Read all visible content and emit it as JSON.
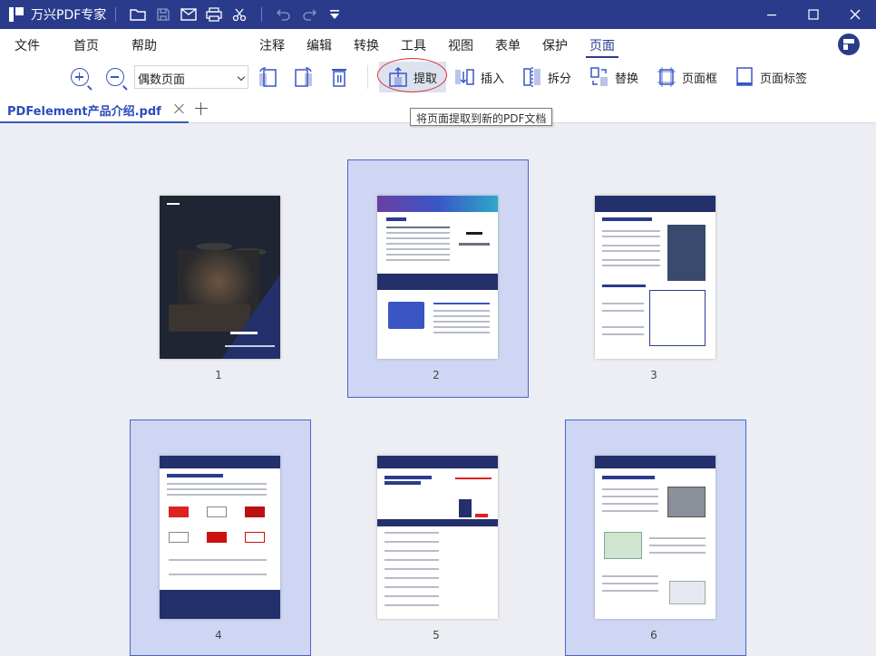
{
  "app": {
    "title": "万兴PDF专家"
  },
  "menu": {
    "left": [
      "文件",
      "首页",
      "帮助"
    ],
    "right": [
      "注释",
      "编辑",
      "转换",
      "工具",
      "视图",
      "表单",
      "保护",
      "页面"
    ],
    "active": "页面"
  },
  "toolbar": {
    "page_mode_value": "偶数页面",
    "extract_label": "提取",
    "insert_label": "插入",
    "split_label": "拆分",
    "replace_label": "替换",
    "page_box_label": "页面框",
    "page_label_label": "页面标签"
  },
  "tab": {
    "filename": "PDFelement产品介绍.pdf"
  },
  "tooltip": {
    "text": "将页面提取到新的PDF文档"
  },
  "thumbnails": [
    {
      "number": "1",
      "selected": false
    },
    {
      "number": "2",
      "selected": true
    },
    {
      "number": "3",
      "selected": false
    },
    {
      "number": "4",
      "selected": true
    },
    {
      "number": "5",
      "selected": false
    },
    {
      "number": "6",
      "selected": true
    }
  ],
  "colors": {
    "brand": "#2b3b8c",
    "selection": "#cfd6f3",
    "highlight_ring": "#d9282f"
  }
}
